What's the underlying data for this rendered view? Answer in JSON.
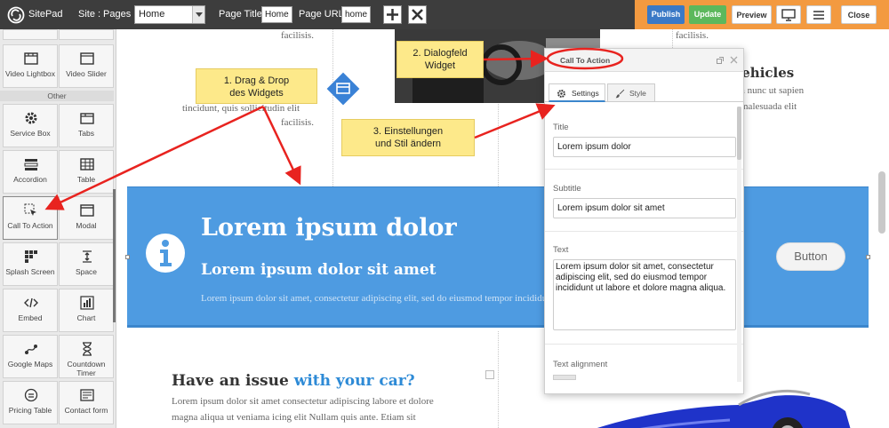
{
  "topbar": {
    "brand": "SitePad",
    "site_label": "Site :",
    "pages_label": "Pages :",
    "pages_value": "Home",
    "page_title_label": "Page Title:",
    "page_title_value": "Home",
    "page_url_label": "Page URL:",
    "page_url_value": "home",
    "add_icon": "plus-icon",
    "close_icon": "x-icon",
    "publish": "Publish",
    "update": "Update",
    "preview": "Preview",
    "close": "Close",
    "colors": {
      "bar": "#3d3d3d",
      "orange": "#f39a40",
      "publish": "#3a79c6",
      "update": "#5cb85c"
    }
  },
  "sidebar": {
    "row0": [
      "",
      ""
    ],
    "row1": [
      "Video Lightbox",
      "Video Slider"
    ],
    "other_label": "Other",
    "widgets": [
      [
        "Service Box",
        "Tabs"
      ],
      [
        "Accordion",
        "Table"
      ],
      [
        "Call To Action",
        "Modal"
      ],
      [
        "Splash Screen",
        "Space"
      ],
      [
        "Embed",
        "Chart"
      ],
      [
        "Google Maps",
        "Countdown Timer"
      ],
      [
        "Pricing Table",
        "Contact form"
      ]
    ]
  },
  "canvas": {
    "left_text_1": "facilisis.",
    "left_text_2": "tincidunt, quis sollicitudin elit",
    "left_text_3": "facilisis.",
    "right_text_1": "facilisis.",
    "right_heading": "Vehicles",
    "right_text_2": "a nunc ut sapien",
    "right_text_3": "malesuada elit",
    "hero": {
      "title": "Lorem ipsum dolor",
      "subtitle": "Lorem ipsum dolor sit amet",
      "text": "Lorem ipsum dolor sit amet, consectetur adipiscing elit, sed do eiusmod tempor incididunt ut labore et dolore magna aliqua.",
      "button": "Button",
      "color": "#4e9be1"
    },
    "issue_heading_1": "Have an issue",
    "issue_heading_2": "with your car?",
    "issue_text_1": "Lorem ipsum dolor sit amet consectetur adipiscing labore et dolore",
    "issue_text_2": "magna aliqua ut veniama icing elit Nullam quis ante. Etiam sit"
  },
  "dialog": {
    "title": "Call To Action",
    "tab_settings": "Settings",
    "tab_style": "Style",
    "title_label": "Title",
    "title_value": "Lorem ipsum dolor",
    "subtitle_label": "Subtitle",
    "subtitle_value": "Lorem ipsum dolor sit amet",
    "text_label": "Text",
    "text_value": "Lorem ipsum dolor sit amet, consectetur adipiscing elit, sed do eiusmod tempor incididunt ut labore et dolore magna aliqua.",
    "alignment_label": "Text alignment"
  },
  "notes": {
    "note1_line1": "1. Drag & Drop",
    "note1_line2": "des Widgets",
    "note2_line1": "2. Dialogfeld",
    "note2_line2": "Widget",
    "note3_line1": "3. Einstellungen",
    "note3_line2": "und Stil ändern",
    "arrow_color": "#e8231f"
  }
}
